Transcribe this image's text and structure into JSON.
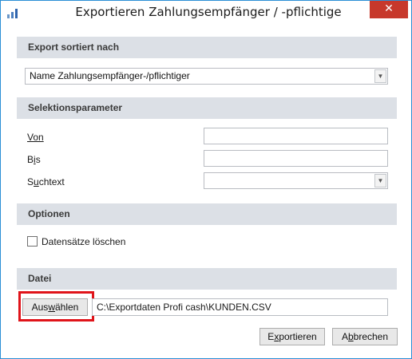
{
  "window": {
    "title": "Exportieren Zahlungsempfänger / -pflichtige",
    "close_glyph": "✕"
  },
  "sort": {
    "header": "Export sortiert nach",
    "selected": "Name Zahlungsempfänger-/pflichtiger"
  },
  "selection": {
    "header": "Selektionsparameter",
    "von_label": "Von",
    "von_value": "",
    "bis_label_pre": "B",
    "bis_label_u": "i",
    "bis_label_post": "s",
    "bis_value": "",
    "suchtext_label_pre": "S",
    "suchtext_label_u": "u",
    "suchtext_label_post": "chtext",
    "suchtext_value": ""
  },
  "options": {
    "header": "Optionen",
    "delete_label": "Datensätze löschen",
    "delete_checked": false
  },
  "file": {
    "header": "Datei",
    "choose_pre": "Aus",
    "choose_u": "w",
    "choose_post": "ählen",
    "path": "C:\\Exportdaten Profi cash\\KUNDEN.CSV"
  },
  "actions": {
    "export_pre": "E",
    "export_u": "x",
    "export_post": "portieren",
    "cancel_pre": "A",
    "cancel_u": "b",
    "cancel_post": "brechen"
  },
  "colors": {
    "accent": "#2b8fd6",
    "close": "#c7382b",
    "highlight": "#e0141a",
    "section_bg": "#dce0e6"
  }
}
